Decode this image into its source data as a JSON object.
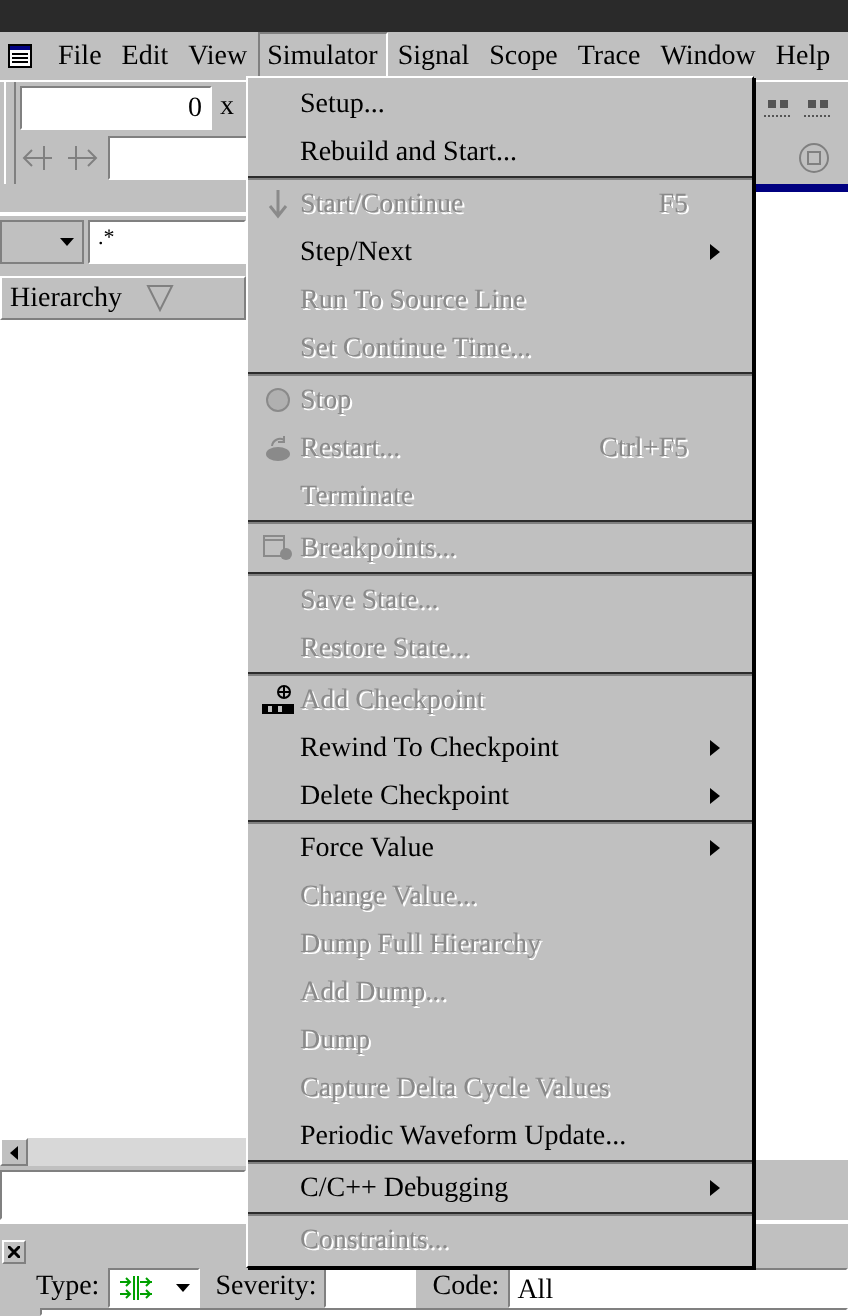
{
  "menubar": [
    {
      "label": "File",
      "selected": false
    },
    {
      "label": "Edit",
      "selected": false
    },
    {
      "label": "View",
      "selected": false
    },
    {
      "label": "Simulator",
      "selected": true
    },
    {
      "label": "Signal",
      "selected": false
    },
    {
      "label": "Scope",
      "selected": false
    },
    {
      "label": "Trace",
      "selected": false
    },
    {
      "label": "Window",
      "selected": false
    },
    {
      "label": "Help",
      "selected": false
    }
  ],
  "toolbar": {
    "time_value": "0",
    "time_unit": "x"
  },
  "filter": {
    "value": ".*"
  },
  "hierarchy": {
    "header": "Hierarchy"
  },
  "messages": {
    "type_label": "Type:",
    "severity_label": "Severity:",
    "code_label": "Code:",
    "code_value": "All"
  },
  "menu": {
    "sections": [
      [
        {
          "label": "Setup...",
          "disabled": false,
          "submenu": false
        },
        {
          "label": "Rebuild and Start...",
          "disabled": false,
          "submenu": false
        }
      ],
      [
        {
          "label": "Start/Continue",
          "disabled": true,
          "submenu": false,
          "shortcut": "F5"
        },
        {
          "label": "Step/Next",
          "disabled": false,
          "submenu": true
        },
        {
          "label": "Run To Source Line",
          "disabled": true,
          "submenu": false
        },
        {
          "label": "Set Continue Time...",
          "disabled": true,
          "submenu": false
        }
      ],
      [
        {
          "label": "Stop",
          "disabled": true,
          "submenu": false
        },
        {
          "label": "Restart...",
          "disabled": true,
          "submenu": false,
          "shortcut": "Ctrl+F5"
        },
        {
          "label": "Terminate",
          "disabled": true,
          "submenu": false
        }
      ],
      [
        {
          "label": "Breakpoints...",
          "disabled": true,
          "submenu": false
        }
      ],
      [
        {
          "label": "Save State...",
          "disabled": true,
          "submenu": false
        },
        {
          "label": "Restore State...",
          "disabled": true,
          "submenu": false
        }
      ],
      [
        {
          "label": "Add Checkpoint",
          "disabled": true,
          "submenu": false
        },
        {
          "label": "Rewind To Checkpoint",
          "disabled": false,
          "submenu": true
        },
        {
          "label": "Delete Checkpoint",
          "disabled": false,
          "submenu": true
        }
      ],
      [
        {
          "label": "Force Value",
          "disabled": false,
          "submenu": true
        },
        {
          "label": "Change Value...",
          "disabled": true,
          "submenu": false
        },
        {
          "label": "Dump Full Hierarchy",
          "disabled": true,
          "submenu": false
        },
        {
          "label": "Add Dump...",
          "disabled": true,
          "submenu": false
        },
        {
          "label": "Dump",
          "disabled": true,
          "submenu": false
        },
        {
          "label": "Capture Delta Cycle Values",
          "disabled": true,
          "submenu": false
        },
        {
          "label": "Periodic Waveform Update...",
          "disabled": false,
          "submenu": false
        }
      ],
      [
        {
          "label": "C/C++ Debugging",
          "disabled": false,
          "submenu": true
        }
      ],
      [
        {
          "label": "Constraints...",
          "disabled": true,
          "submenu": false
        }
      ]
    ]
  }
}
